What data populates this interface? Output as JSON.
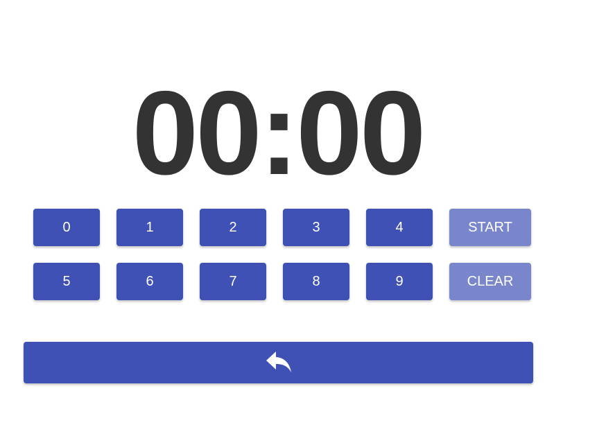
{
  "timer": {
    "display": "00:00"
  },
  "keypad": {
    "row1": [
      "0",
      "1",
      "2",
      "3",
      "4"
    ],
    "row2": [
      "5",
      "6",
      "7",
      "8",
      "9"
    ],
    "start_label": "START",
    "clear_label": "CLEAR"
  },
  "back_button": {
    "icon": "reply-arrow-icon"
  },
  "colors": {
    "primary": "#3f51b5",
    "primary_light": "#7986cb",
    "timer_text": "#333333"
  }
}
